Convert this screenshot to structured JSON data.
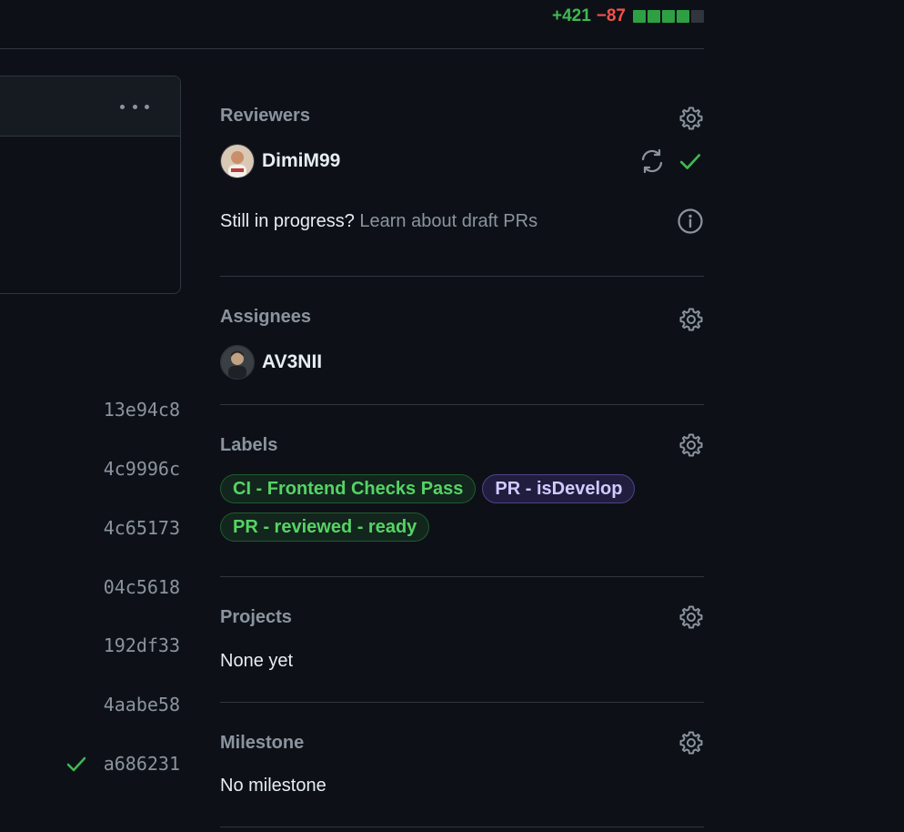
{
  "header": {
    "additions": "+421",
    "deletions": "−87",
    "diff_blocks": [
      "green",
      "green",
      "green",
      "green",
      "neutral"
    ]
  },
  "left_panel": {
    "more_options_icon": "kebab-horizontal-icon"
  },
  "commits": [
    {
      "sha": "13e94c8",
      "checked": false
    },
    {
      "sha": "4c9996c",
      "checked": false
    },
    {
      "sha": "4c65173",
      "checked": false
    },
    {
      "sha": "04c5618",
      "checked": false
    },
    {
      "sha": "192df33",
      "checked": false
    },
    {
      "sha": "4aabe58",
      "checked": false
    },
    {
      "sha": "a686231",
      "checked": true
    }
  ],
  "sidebar": {
    "reviewers": {
      "title": "Reviewers",
      "reviewer_name": "DimiM99",
      "draft_prompt": "Still in progress?",
      "draft_link": "Learn about draft PRs"
    },
    "assignees": {
      "title": "Assignees",
      "assignee_name": "AV3NII"
    },
    "labels": {
      "title": "Labels",
      "items": [
        "CI - Frontend Checks Pass",
        "PR - isDevelop",
        "PR - reviewed - ready"
      ]
    },
    "projects": {
      "title": "Projects",
      "value": "None yet"
    },
    "milestone": {
      "title": "Milestone",
      "value": "No milestone"
    }
  },
  "colors": {
    "background": "#0d1117",
    "accent_green": "#3fb950",
    "accent_red": "#f85149",
    "muted": "#8b949e",
    "border": "#30363d"
  }
}
